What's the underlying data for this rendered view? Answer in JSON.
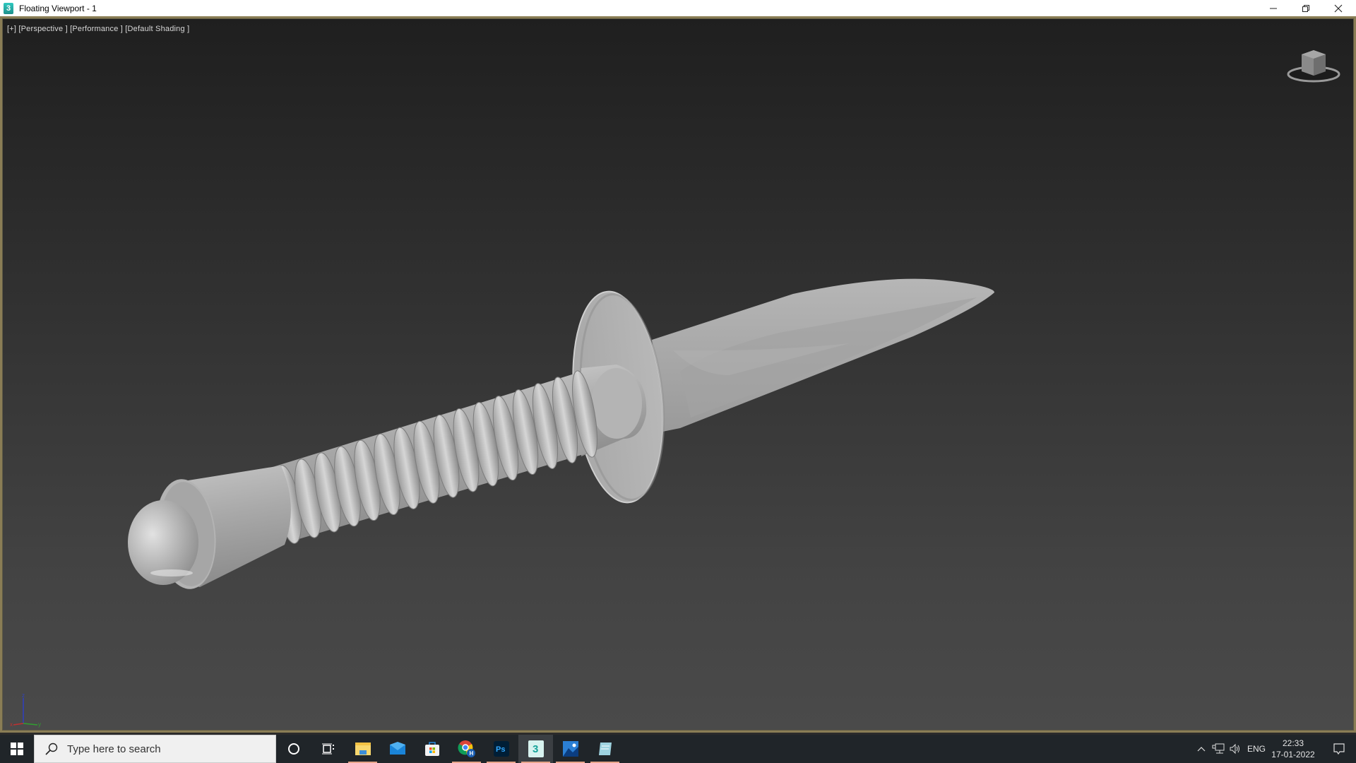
{
  "window": {
    "title": "Floating Viewport - 1",
    "app_icon": "3ds-max-icon",
    "controls": [
      "minimize",
      "restore",
      "close"
    ]
  },
  "viewport": {
    "label": "[+] [Perspective ] [Performance ] [Default Shading ]",
    "viewcube": "viewcube-icon",
    "axis_labels": {
      "x": "x",
      "y": "y",
      "z": "z"
    },
    "axis_colors": {
      "x": "#c03030",
      "y": "#30a030",
      "z": "#3040c0"
    },
    "object": "dagger-model",
    "border_color": "#8a7d55"
  },
  "taskbar": {
    "search_placeholder": "Type here to search",
    "apps": [
      {
        "name": "cortana",
        "active": false,
        "running": false
      },
      {
        "name": "task-view",
        "active": false,
        "running": false
      },
      {
        "name": "file-explorer",
        "active": false,
        "running": true
      },
      {
        "name": "mail",
        "active": false,
        "running": false
      },
      {
        "name": "microsoft-store",
        "active": false,
        "running": false
      },
      {
        "name": "chrome",
        "active": false,
        "running": true
      },
      {
        "name": "photoshop",
        "active": false,
        "running": true
      },
      {
        "name": "3ds-max",
        "active": true,
        "running": true
      },
      {
        "name": "photos",
        "active": false,
        "running": true
      },
      {
        "name": "notepad",
        "active": false,
        "running": true
      }
    ],
    "tray": {
      "language": "ENG",
      "time": "22:33",
      "date": "17-01-2022"
    }
  }
}
